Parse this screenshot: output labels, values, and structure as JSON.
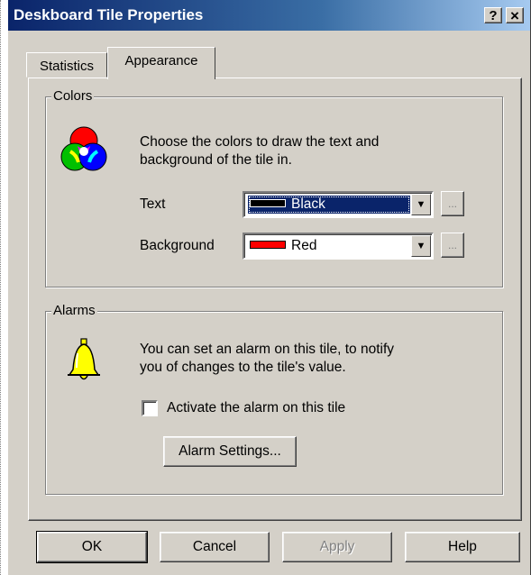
{
  "window": {
    "title": "Deskboard Tile Properties",
    "help_button": "?",
    "close_button": "×"
  },
  "tabs": [
    {
      "label": "Statistics",
      "active": false
    },
    {
      "label": "Appearance",
      "active": true
    }
  ],
  "colors_group": {
    "legend": "Colors",
    "icon": "color-circles-icon",
    "description_line1": "Choose the colors to draw the text and",
    "description_line2": "background of the tile in.",
    "text_label": "Text",
    "text_value": "Black",
    "text_swatch_color": "#000000",
    "background_label": "Background",
    "background_value": "Red",
    "background_swatch_color": "#ff0000",
    "more_button": "..."
  },
  "alarms_group": {
    "legend": "Alarms",
    "icon": "bell-icon",
    "description_line1": "You can set an alarm on this tile, to notify",
    "description_line2": "you of changes to the tile's value.",
    "checkbox_label": "Activate the alarm on this tile",
    "checkbox_checked": false,
    "settings_button": "Alarm Settings..."
  },
  "footer": {
    "ok": "OK",
    "cancel": "Cancel",
    "apply": "Apply",
    "help": "Help"
  },
  "colors": {
    "titlebar_start": "#0a246a",
    "face": "#d4d0c8",
    "selection": "#0a246a"
  }
}
